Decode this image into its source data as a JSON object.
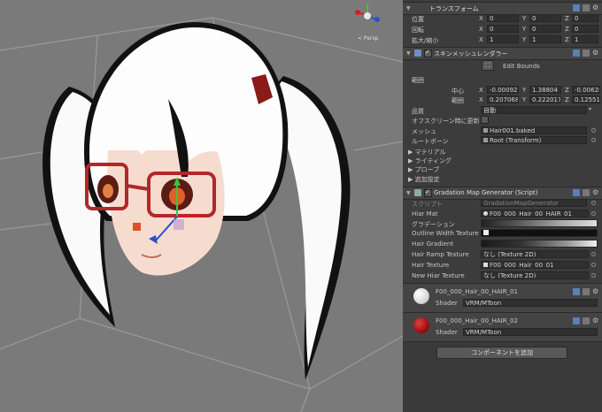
{
  "scene": {
    "persp_label": "< Persp"
  },
  "transform": {
    "title": "トランスフォーム",
    "rows": [
      {
        "label": "位置",
        "x": "0",
        "y": "0",
        "z": "0"
      },
      {
        "label": "回転",
        "x": "0",
        "y": "0",
        "z": "0"
      },
      {
        "label": "拡大/縮小",
        "x": "1",
        "y": "1",
        "z": "1"
      }
    ]
  },
  "skinned_mesh": {
    "title": "スキンメッシュレンダラー",
    "edit_bounds": "Edit Bounds",
    "bounds_label": "範囲",
    "center_label": "中心",
    "center": {
      "x": "-0.000927",
      "y": "1.38804",
      "z": "-0.006283"
    },
    "extent_label": "範囲",
    "extent": {
      "x": "0.2070685",
      "y": "0.222017",
      "z": "0.12551"
    },
    "quality_label": "品質",
    "quality_value": "自動",
    "offscreen_label": "オフスクリーン時に更新",
    "mesh_label": "メッシュ",
    "mesh_value": "Hair001.baked",
    "root_bone_label": "ルートボーン",
    "root_bone_value": "Root (Transform)",
    "foldouts": [
      "マテリアル",
      "ライティング",
      "プローブ",
      "追加設定"
    ]
  },
  "script": {
    "title": "Gradation Map Generator (Script)",
    "script_label": "スクリプト",
    "script_value": "GradationMapGenerator",
    "fields": [
      {
        "label": "Hiar Mat",
        "value": "F00_000_Hair_00_HAIR_01"
      },
      {
        "label": "グラデーション",
        "value": ""
      },
      {
        "label": "Outline Width Texture",
        "value": ""
      },
      {
        "label": "Hair Gradient",
        "value": ""
      },
      {
        "label": "Hair Ramp Texture",
        "value": "なし (Texture 2D)"
      },
      {
        "label": "Hair Texture",
        "value": "F00_000_Hair_00_01"
      },
      {
        "label": "New Hiar Texture",
        "value": "なし (Texture 2D)"
      }
    ]
  },
  "materials": [
    {
      "name": "F00_000_Hair_00_HAIR_01",
      "shader_label": "Shader",
      "shader": "VRM/MToon",
      "color": "#f4f4f4"
    },
    {
      "name": "F00_000_Hair_00_HAIR_02",
      "shader_label": "Shader",
      "shader": "VRM/MToon",
      "color": "#b01818"
    }
  ],
  "add_component": "コンポーネントを追加",
  "colors": {
    "accent": "#6d8fbf",
    "hair_ribbon": "#8b1a1a",
    "glasses": "#b0282a"
  }
}
